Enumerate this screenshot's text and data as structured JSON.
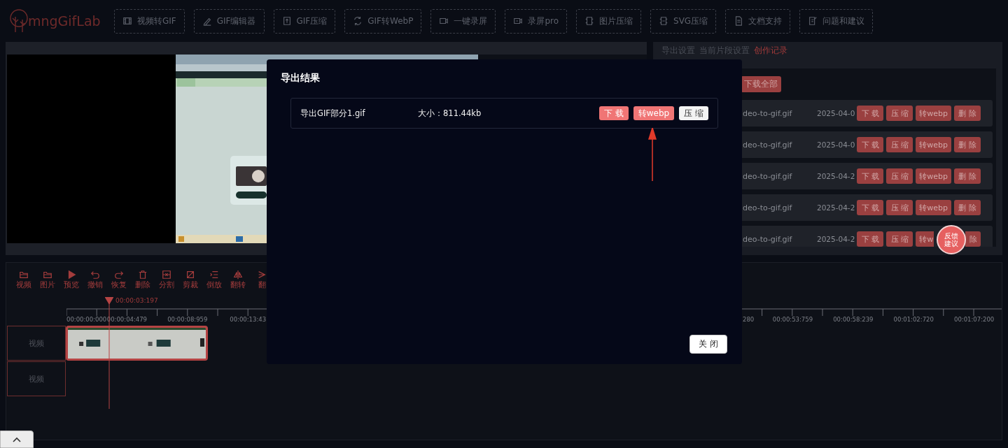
{
  "header": {
    "logo": "mngGifLab",
    "nav": [
      "视频转GIF",
      "GIF编辑器",
      "GIF压缩",
      "GIF转WebP",
      "一键录屏",
      "录屏pro",
      "图片压缩",
      "SVG压缩",
      "文档支持",
      "问题和建议"
    ]
  },
  "side_panel": {
    "tabs": [
      {
        "label": "导出设置",
        "selected": false
      },
      {
        "label": "当前片段设置",
        "selected": false
      },
      {
        "label": "创作记录",
        "selected": true
      }
    ],
    "download_all": "下载全部",
    "records": [
      {
        "file": "deo-to-gif.gif",
        "date": "2025-04-0",
        "actions": [
          {
            "label": "下 载"
          },
          {
            "label": "压 缩"
          },
          {
            "label": "转webp"
          },
          {
            "label": "删 除"
          }
        ]
      },
      {
        "file": "deo-to-gif.gif",
        "date": "2025-04-0",
        "actions": [
          {
            "label": "下 载"
          },
          {
            "label": "压 缩"
          },
          {
            "label": "转webp"
          },
          {
            "label": "删 除"
          }
        ]
      },
      {
        "file": "deo-to-gif.gif",
        "date": "2025-04-2",
        "actions": [
          {
            "label": "下 载"
          },
          {
            "label": "压 缩"
          },
          {
            "label": "转webp"
          },
          {
            "label": "删 除"
          }
        ]
      },
      {
        "file": "deo-to-gif.gif",
        "date": "2025-04-2",
        "actions": [
          {
            "label": "下 载"
          },
          {
            "label": "压 缩"
          },
          {
            "label": "转webp"
          },
          {
            "label": "删 除"
          }
        ]
      },
      {
        "file": "deo-to-gif.gif",
        "date": "2025-04-2",
        "actions": [
          {
            "label": "下 载"
          },
          {
            "label": "压 缩"
          },
          {
            "label": "转w",
            "kind": "head"
          },
          {
            "label": "除",
            "kind": "tail"
          }
        ]
      }
    ],
    "feedback": "反馈建议"
  },
  "timeline": {
    "tools": [
      "视频",
      "图片",
      "预览",
      "撤销",
      "恢复",
      "删除",
      "分割",
      "剪裁",
      "倒放",
      "翻转",
      "翻"
    ],
    "playhead": "00:00:03:197",
    "ruler_start": [
      "00:00:00:000",
      "00:00:04:479",
      "00:00:08:959",
      "00:00:13:43"
    ],
    "ruler_end": [
      "280",
      "00:00:53:759",
      "00:00:58:239",
      "00:01:02:720",
      "00:01:07:200"
    ],
    "tracks": [
      "视频",
      "视频"
    ]
  },
  "dialog": {
    "title": "导出结果",
    "file": "导出GIF部分1.gif",
    "size": "大小：811.44kb",
    "actions": [
      {
        "label": "下 载",
        "kind": "primary"
      },
      {
        "label": "转webp",
        "kind": "primary"
      },
      {
        "label": "压 缩",
        "kind": "plain"
      }
    ],
    "close": "关 闭"
  }
}
